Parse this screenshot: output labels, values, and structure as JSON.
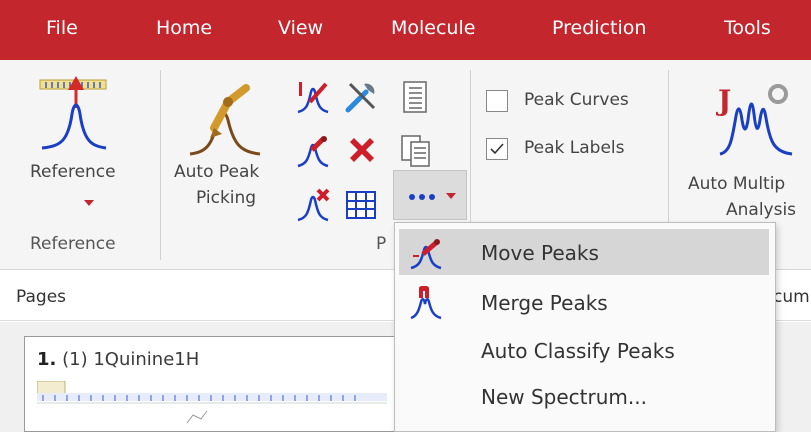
{
  "menubar": {
    "items": [
      "File",
      "Home",
      "View",
      "Molecule",
      "Prediction",
      "Tools"
    ]
  },
  "ribbon": {
    "reference_button_label": "Reference",
    "reference_group_label": "Reference",
    "auto_peak_line1": "Auto Peak",
    "auto_peak_line2": "Picking",
    "peaks_group_label_visible": "P",
    "peak_curves_label": "Peak Curves",
    "peak_curves_checked": false,
    "peak_labels_label": "Peak Labels",
    "peak_labels_checked": true,
    "auto_multiplet_line1": "Auto Multip",
    "auto_multiplet_line2": "Analysis"
  },
  "pages": {
    "title": "Pages",
    "right_tab_label": "cum",
    "thumbnail_number": "1.",
    "thumbnail_index": "(1)",
    "thumbnail_name": "1Quinine1H"
  },
  "dropdown": {
    "items": [
      {
        "label": "Move Peaks",
        "icon": "move-peaks-icon",
        "active": true
      },
      {
        "label": "Merge Peaks",
        "icon": "merge-peaks-icon",
        "active": false
      },
      {
        "label": "Auto Classify Peaks",
        "icon": "",
        "active": false
      },
      {
        "label": "New Spectrum...",
        "icon": "",
        "active": false
      }
    ]
  },
  "colors": {
    "menubar_bg": "#c4262e",
    "ribbon_bg": "#f5f5f5",
    "accent_blue": "#1b3fc4",
    "accent_red": "#cc1f2b"
  }
}
